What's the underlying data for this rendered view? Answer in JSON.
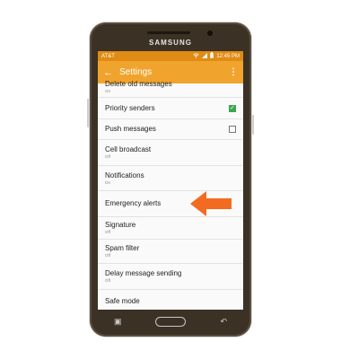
{
  "device": {
    "brand": "SAMSUNG"
  },
  "status_bar": {
    "carrier": "AT&T",
    "time": "12:45 PM"
  },
  "app_bar": {
    "back_icon": "back-arrow-icon",
    "title": "Settings",
    "menu_icon": "more-vert-icon"
  },
  "settings": [
    {
      "label": "Delete old messages",
      "sub": "On"
    },
    {
      "label": "Priority senders",
      "checkbox": true,
      "checked": true
    },
    {
      "label": "Push messages",
      "checkbox": true,
      "checked": false
    },
    {
      "label": "Cell broadcast",
      "sub": "Off"
    },
    {
      "label": "Notifications",
      "sub": "On"
    },
    {
      "label": "Emergency alerts"
    },
    {
      "label": "Signature",
      "sub": "Off"
    },
    {
      "label": "Spam filter",
      "sub": "Off"
    },
    {
      "label": "Delay message sending",
      "sub": "Off"
    },
    {
      "label": "Safe mode"
    }
  ],
  "colors": {
    "status_bar": "#e08b14",
    "app_bar": "#f0a42e",
    "arrow": "#f36b21",
    "checkbox_checked": "#3aa84c"
  }
}
